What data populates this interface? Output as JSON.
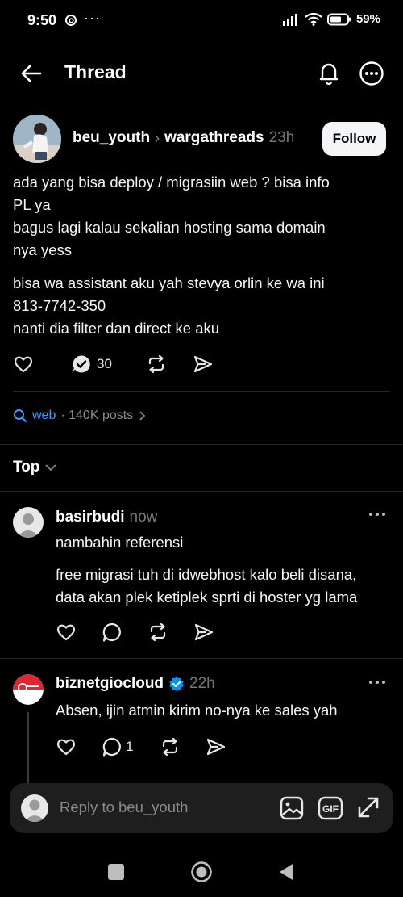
{
  "status_bar": {
    "time": "9:50",
    "dots": "···",
    "battery_percent": "59%",
    "icons": [
      "threads-icon",
      "signal-icon",
      "wifi-icon",
      "battery-icon"
    ]
  },
  "header": {
    "title": "Thread",
    "icons": [
      "back-arrow-icon",
      "bell-icon",
      "more-icon"
    ]
  },
  "post": {
    "username": "beu_youth",
    "community": "wargathreads",
    "time": "23h",
    "follow_label": "Follow",
    "paragraph1": "ada yang bisa deploy / migrasiin web ? bisa info\nPL ya\nbagus lagi kalau sekalian hosting sama domain\nnya yess",
    "paragraph2": "bisa wa assistant aku yah stevya orlin ke wa ini\n813-7742-350\nnanti dia filter dan direct ke aku",
    "reply_count": "30",
    "icons": [
      "heart-icon",
      "reply-count-icon",
      "repost-icon",
      "share-icon"
    ]
  },
  "topic": {
    "name": "web",
    "meta": "· 140K posts"
  },
  "sort": {
    "label": "Top"
  },
  "replies": [
    {
      "username": "basirbudi",
      "time": "now",
      "paragraph1": "nambahin referensi",
      "paragraph2": "free migrasi tuh di idwebhost kalo beli disana,\ndata akan plek ketiplek sprti di hoster yg lama",
      "reply_count": ""
    },
    {
      "username": "biznetgiocloud",
      "verified": true,
      "time": "22h",
      "paragraph1": "Absen, ijin atmin kirim no-nya ke sales yah",
      "reply_count": "1"
    }
  ],
  "composer": {
    "placeholder": "Reply to beu_youth",
    "icons": [
      "image-icon",
      "gif-icon",
      "expand-icon"
    ]
  },
  "nav": {
    "icons": [
      "recents-icon",
      "home-icon",
      "back-icon"
    ]
  },
  "colors": {
    "background": "#000000",
    "text": "#f3f5f7",
    "muted": "#777777",
    "link": "#3f98ff",
    "verified": "#0095f6",
    "composer_bg": "#1e1e1e"
  }
}
